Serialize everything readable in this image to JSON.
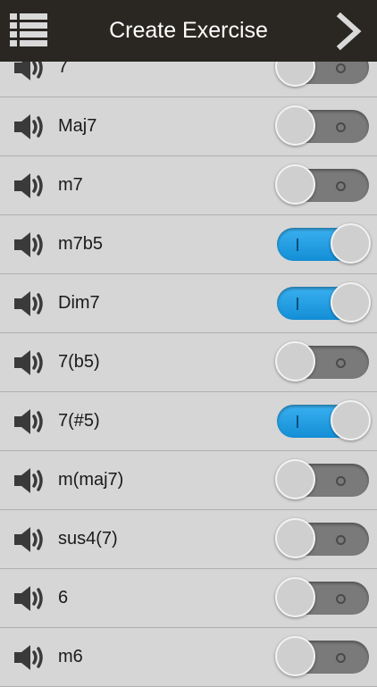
{
  "header": {
    "title": "Create Exercise",
    "menu_icon": "list-menu-icon",
    "next_icon": "chevron-right-icon"
  },
  "colors": {
    "header_bg": "#2a2622",
    "toggle_on": "#1e9be3",
    "toggle_off": "#7a7a7a",
    "row_bg": "#d6d6d6"
  },
  "chords": [
    {
      "label": "7",
      "enabled": false
    },
    {
      "label": "Maj7",
      "enabled": false
    },
    {
      "label": "m7",
      "enabled": false
    },
    {
      "label": "m7b5",
      "enabled": true
    },
    {
      "label": "Dim7",
      "enabled": true
    },
    {
      "label": "7(b5)",
      "enabled": false
    },
    {
      "label": "7(#5)",
      "enabled": true
    },
    {
      "label": "m(maj7)",
      "enabled": false
    },
    {
      "label": "sus4(7)",
      "enabled": false
    },
    {
      "label": "6",
      "enabled": false
    },
    {
      "label": "m6",
      "enabled": false
    }
  ]
}
